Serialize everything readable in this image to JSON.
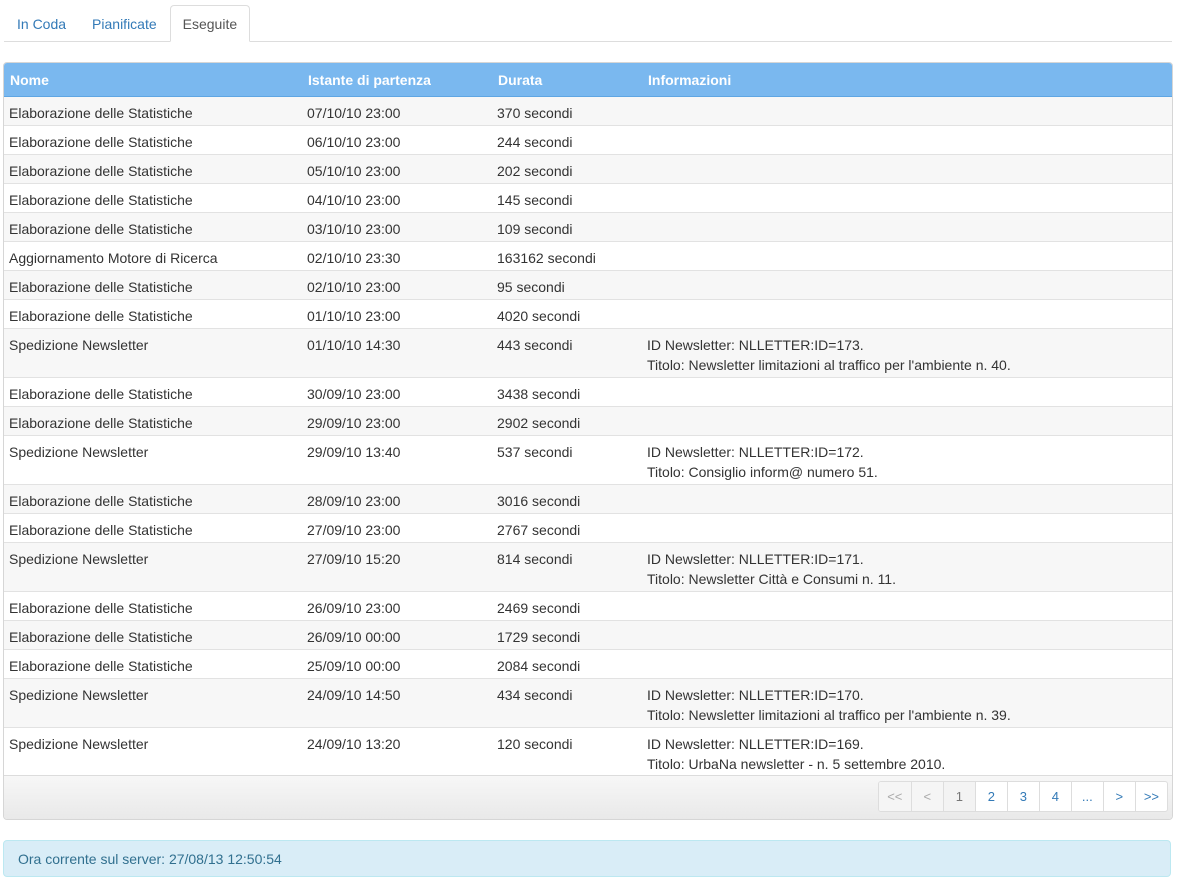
{
  "tabs": [
    {
      "label": "In Coda",
      "active": false
    },
    {
      "label": "Pianificate",
      "active": false
    },
    {
      "label": "Eseguite",
      "active": true
    }
  ],
  "table": {
    "headers": [
      "Nome",
      "Istante di partenza",
      "Durata",
      "Informazioni"
    ],
    "rows": [
      {
        "nome": "Elaborazione delle Statistiche",
        "start": "07/10/10 23:00",
        "durata": "370 secondi",
        "info": []
      },
      {
        "nome": "Elaborazione delle Statistiche",
        "start": "06/10/10 23:00",
        "durata": "244 secondi",
        "info": []
      },
      {
        "nome": "Elaborazione delle Statistiche",
        "start": "05/10/10 23:00",
        "durata": "202 secondi",
        "info": []
      },
      {
        "nome": "Elaborazione delle Statistiche",
        "start": "04/10/10 23:00",
        "durata": "145 secondi",
        "info": []
      },
      {
        "nome": "Elaborazione delle Statistiche",
        "start": "03/10/10 23:00",
        "durata": "109 secondi",
        "info": []
      },
      {
        "nome": "Aggiornamento Motore di Ricerca",
        "start": "02/10/10 23:30",
        "durata": "163162 secondi",
        "info": []
      },
      {
        "nome": "Elaborazione delle Statistiche",
        "start": "02/10/10 23:00",
        "durata": "95 secondi",
        "info": []
      },
      {
        "nome": "Elaborazione delle Statistiche",
        "start": "01/10/10 23:00",
        "durata": "4020 secondi",
        "info": []
      },
      {
        "nome": "Spedizione Newsletter",
        "start": "01/10/10 14:30",
        "durata": "443 secondi",
        "info": [
          "ID Newsletter: NLLETTER:ID=173.",
          "Titolo: Newsletter limitazioni al traffico per l'ambiente n. 40."
        ]
      },
      {
        "nome": "Elaborazione delle Statistiche",
        "start": "30/09/10 23:00",
        "durata": "3438 secondi",
        "info": []
      },
      {
        "nome": "Elaborazione delle Statistiche",
        "start": "29/09/10 23:00",
        "durata": "2902 secondi",
        "info": []
      },
      {
        "nome": "Spedizione Newsletter",
        "start": "29/09/10 13:40",
        "durata": "537 secondi",
        "info": [
          "ID Newsletter: NLLETTER:ID=172.",
          "Titolo: Consiglio inform@ numero 51."
        ]
      },
      {
        "nome": "Elaborazione delle Statistiche",
        "start": "28/09/10 23:00",
        "durata": "3016 secondi",
        "info": []
      },
      {
        "nome": "Elaborazione delle Statistiche",
        "start": "27/09/10 23:00",
        "durata": "2767 secondi",
        "info": []
      },
      {
        "nome": "Spedizione Newsletter",
        "start": "27/09/10 15:20",
        "durata": "814 secondi",
        "info": [
          "ID Newsletter: NLLETTER:ID=171.",
          "Titolo: Newsletter Città e Consumi n. 11."
        ]
      },
      {
        "nome": "Elaborazione delle Statistiche",
        "start": "26/09/10 23:00",
        "durata": "2469 secondi",
        "info": []
      },
      {
        "nome": "Elaborazione delle Statistiche",
        "start": "26/09/10 00:00",
        "durata": "1729 secondi",
        "info": []
      },
      {
        "nome": "Elaborazione delle Statistiche",
        "start": "25/09/10 00:00",
        "durata": "2084 secondi",
        "info": []
      },
      {
        "nome": "Spedizione Newsletter",
        "start": "24/09/10 14:50",
        "durata": "434 secondi",
        "info": [
          "ID Newsletter: NLLETTER:ID=170.",
          "Titolo: Newsletter limitazioni al traffico per l'ambiente n. 39."
        ]
      },
      {
        "nome": "Spedizione Newsletter",
        "start": "24/09/10 13:20",
        "durata": "120 secondi",
        "info": [
          "ID Newsletter: NLLETTER:ID=169.",
          "Titolo: UrbaNa newsletter - n. 5 settembre 2010."
        ]
      }
    ]
  },
  "pager": [
    {
      "label": "<<",
      "state": "disabled"
    },
    {
      "label": "<",
      "state": "disabled"
    },
    {
      "label": "1",
      "state": "current"
    },
    {
      "label": "2",
      "state": "link"
    },
    {
      "label": "3",
      "state": "link"
    },
    {
      "label": "4",
      "state": "link"
    },
    {
      "label": "...",
      "state": "link"
    },
    {
      "label": ">",
      "state": "link"
    },
    {
      "label": ">>",
      "state": "link"
    }
  ],
  "footer": {
    "server_time": "Ora corrente sul server: 27/08/13 12:50:54"
  },
  "colors": {
    "header_bg": "#7ab8ef",
    "link": "#337ab7",
    "info_bg": "#d9edf7",
    "info_text": "#31708f"
  }
}
